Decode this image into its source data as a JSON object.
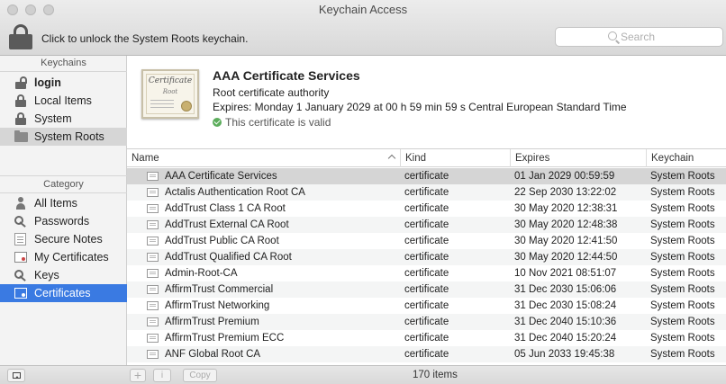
{
  "window": {
    "title": "Keychain Access"
  },
  "toolbar": {
    "unlock_message": "Click to unlock the System Roots keychain.",
    "search_placeholder": "Search"
  },
  "sidebar": {
    "keychains_header": "Keychains",
    "keychains": [
      {
        "label": "login",
        "icon": "open-lock-icon"
      },
      {
        "label": "Local Items",
        "icon": "lock-icon"
      },
      {
        "label": "System",
        "icon": "lock-icon"
      },
      {
        "label": "System Roots",
        "icon": "folder-icon",
        "selected": true
      }
    ],
    "category_header": "Category",
    "categories": [
      {
        "label": "All Items",
        "icon": "people-icon"
      },
      {
        "label": "Passwords",
        "icon": "key-icon"
      },
      {
        "label": "Secure Notes",
        "icon": "note-icon"
      },
      {
        "label": "My Certificates",
        "icon": "certificate-icon"
      },
      {
        "label": "Keys",
        "icon": "key-icon"
      },
      {
        "label": "Certificates",
        "icon": "certificate-icon",
        "selected": true
      }
    ]
  },
  "detail": {
    "cert_image_title": "Certificate",
    "cert_image_subtitle": "Root",
    "name": "AAA Certificate Services",
    "type": "Root certificate authority",
    "expires": "Expires: Monday 1 January 2029 at 00 h 59 min 59 s Central European Standard Time",
    "validity": "This certificate is valid",
    "validity_color": "#5cad5c"
  },
  "table": {
    "columns": [
      "Name",
      "Kind",
      "Expires",
      "Keychain"
    ],
    "rows": [
      {
        "name": "AAA Certificate Services",
        "kind": "certificate",
        "expires": "01 Jan 2029 00:59:59",
        "keychain": "System Roots"
      },
      {
        "name": "Actalis Authentication Root CA",
        "kind": "certificate",
        "expires": "22 Sep 2030 13:22:02",
        "keychain": "System Roots"
      },
      {
        "name": "AddTrust Class 1 CA Root",
        "kind": "certificate",
        "expires": "30 May 2020 12:38:31",
        "keychain": "System Roots"
      },
      {
        "name": "AddTrust External CA Root",
        "kind": "certificate",
        "expires": "30 May 2020 12:48:38",
        "keychain": "System Roots"
      },
      {
        "name": "AddTrust Public CA Root",
        "kind": "certificate",
        "expires": "30 May 2020 12:41:50",
        "keychain": "System Roots"
      },
      {
        "name": "AddTrust Qualified CA Root",
        "kind": "certificate",
        "expires": "30 May 2020 12:44:50",
        "keychain": "System Roots"
      },
      {
        "name": "Admin-Root-CA",
        "kind": "certificate",
        "expires": "10 Nov 2021 08:51:07",
        "keychain": "System Roots"
      },
      {
        "name": "AffirmTrust Commercial",
        "kind": "certificate",
        "expires": "31 Dec 2030 15:06:06",
        "keychain": "System Roots"
      },
      {
        "name": "AffirmTrust Networking",
        "kind": "certificate",
        "expires": "31 Dec 2030 15:08:24",
        "keychain": "System Roots"
      },
      {
        "name": "AffirmTrust Premium",
        "kind": "certificate",
        "expires": "31 Dec 2040 15:10:36",
        "keychain": "System Roots"
      },
      {
        "name": "AffirmTrust Premium ECC",
        "kind": "certificate",
        "expires": "31 Dec 2040 15:20:24",
        "keychain": "System Roots"
      },
      {
        "name": "ANF Global Root CA",
        "kind": "certificate",
        "expires": "05 Jun 2033 19:45:38",
        "keychain": "System Roots"
      }
    ]
  },
  "bottom_bar": {
    "plus_label": "+",
    "info_label": "i",
    "copy_label": "Copy",
    "item_count": "170 items"
  },
  "colors": {
    "selection_blue": "#3a7ae2",
    "selected_row_grey": "#d5d5d5"
  }
}
